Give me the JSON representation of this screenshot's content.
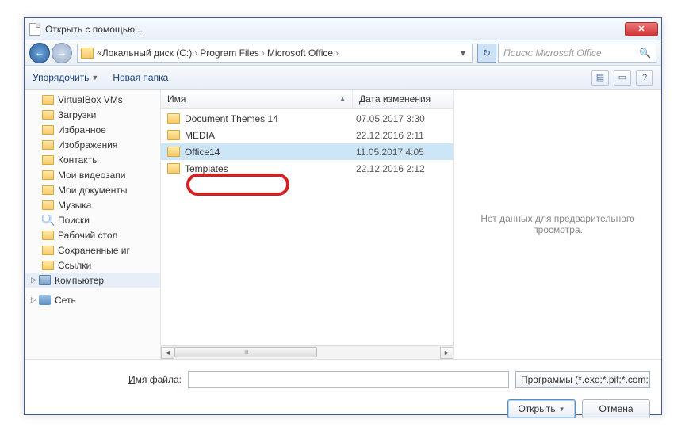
{
  "window": {
    "title": "Открыть с помощью..."
  },
  "nav": {
    "back_icon": "←",
    "forward_icon": "→",
    "refresh_icon": "↻",
    "crumb_prefix": "«",
    "crumbs": [
      "Локальный диск (C:)",
      "Program Files",
      "Microsoft Office"
    ],
    "sep": "›"
  },
  "search": {
    "placeholder": "Поиск: Microsoft Office",
    "icon": "🔍"
  },
  "toolbar": {
    "organize": "Упорядочить",
    "new_folder": "Новая папка",
    "view_icon": "▤",
    "preview_icon": "▭",
    "help_icon": "?"
  },
  "sidebar": {
    "items": [
      {
        "label": "VirtualBox VMs",
        "type": "fldr"
      },
      {
        "label": "Загрузки",
        "type": "fldr"
      },
      {
        "label": "Избранное",
        "type": "fldr"
      },
      {
        "label": "Изображения",
        "type": "fldr"
      },
      {
        "label": "Контакты",
        "type": "fldr"
      },
      {
        "label": "Мои видеозапи",
        "type": "fldr"
      },
      {
        "label": "Мои документы",
        "type": "fldr"
      },
      {
        "label": "Музыка",
        "type": "fldr"
      },
      {
        "label": "Поиски",
        "type": "mag"
      },
      {
        "label": "Рабочий стол",
        "type": "fldr"
      },
      {
        "label": "Сохраненные иг",
        "type": "fldr"
      },
      {
        "label": "Ссылки",
        "type": "fldr"
      }
    ],
    "computer": "Компьютер",
    "network": "Сеть",
    "tri_expand": "▷",
    "tri_collapse": "◢"
  },
  "columns": {
    "name": "Имя",
    "date": "Дата изменения",
    "sort": "▲"
  },
  "files": [
    {
      "name": "Document Themes 14",
      "date": "07.05.2017 3:30",
      "sel": false
    },
    {
      "name": "MEDIA",
      "date": "22.12.2016 2:11",
      "sel": false
    },
    {
      "name": "Office14",
      "date": "11.05.2017 4:05",
      "sel": true
    },
    {
      "name": "Templates",
      "date": "22.12.2016 2:12",
      "sel": false
    }
  ],
  "preview": {
    "text": "Нет данных для предварительного просмотра."
  },
  "bottom": {
    "filename_label_pre": "",
    "filename_label_u": "И",
    "filename_label_post": "мя файла:",
    "filter": "Программы (*.exe;*.pif;*.com;",
    "open": "Открыть",
    "cancel": "Отмена"
  }
}
